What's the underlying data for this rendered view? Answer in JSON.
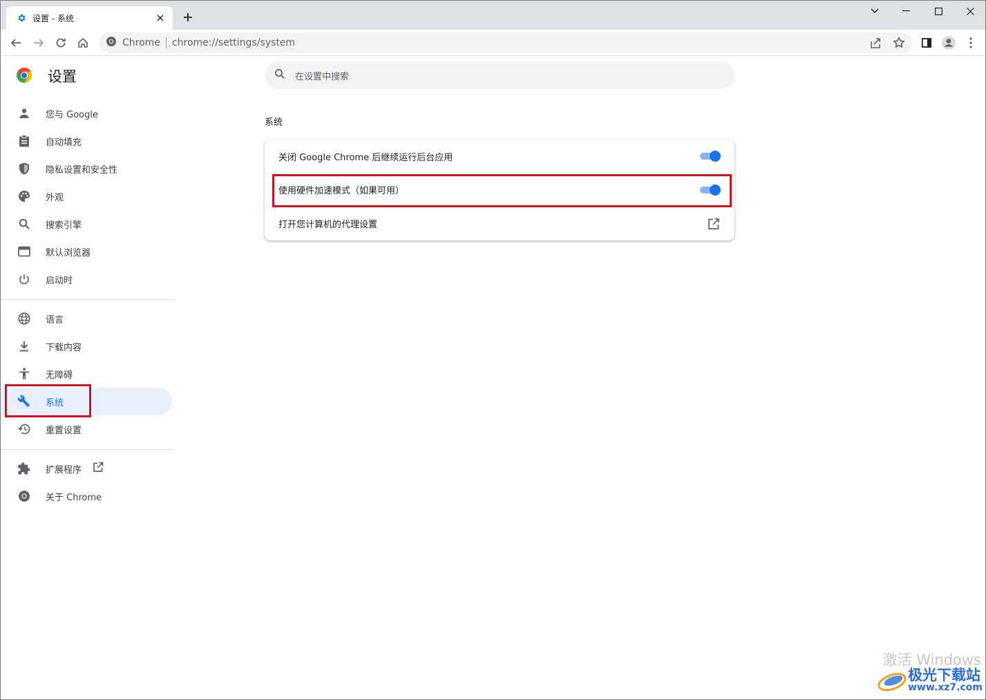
{
  "tab": {
    "title": "设置 - 系统"
  },
  "omnibox": {
    "site": "Chrome",
    "url": "chrome://settings/system"
  },
  "header": {
    "title": "设置"
  },
  "search": {
    "placeholder": "在设置中搜索"
  },
  "sidebar": {
    "items": [
      {
        "label": "您与 Google",
        "icon": "person-icon"
      },
      {
        "label": "自动填充",
        "icon": "clipboard-icon"
      },
      {
        "label": "隐私设置和安全性",
        "icon": "shield-icon"
      },
      {
        "label": "外观",
        "icon": "palette-icon"
      },
      {
        "label": "搜索引擎",
        "icon": "search-icon"
      },
      {
        "label": "默认浏览器",
        "icon": "browser-icon"
      },
      {
        "label": "启动时",
        "icon": "power-icon"
      },
      {
        "label": "语言",
        "icon": "globe-icon"
      },
      {
        "label": "下载内容",
        "icon": "download-icon"
      },
      {
        "label": "无障碍",
        "icon": "accessibility-icon"
      },
      {
        "label": "系统",
        "icon": "wrench-icon",
        "active": true
      },
      {
        "label": "重置设置",
        "icon": "restore-icon"
      },
      {
        "label": "扩展程序",
        "icon": "puzzle-icon"
      },
      {
        "label": "关于 Chrome",
        "icon": "chrome-icon"
      }
    ]
  },
  "main": {
    "section_title": "系统",
    "rows": [
      {
        "label": "关闭 Google Chrome 后继续运行后台应用",
        "type": "toggle",
        "on": true
      },
      {
        "label": "使用硬件加速模式（如果可用）",
        "type": "toggle",
        "on": true
      },
      {
        "label": "打开您计算机的代理设置",
        "type": "external-link"
      }
    ]
  },
  "watermark": {
    "os_text": "激活 Windows",
    "brand": "极光下载站",
    "url": "www.xz7.com"
  },
  "colors": {
    "accent": "#1a73e8",
    "highlight": "#d0121b",
    "active_nav_bg": "#e8f0fe"
  }
}
